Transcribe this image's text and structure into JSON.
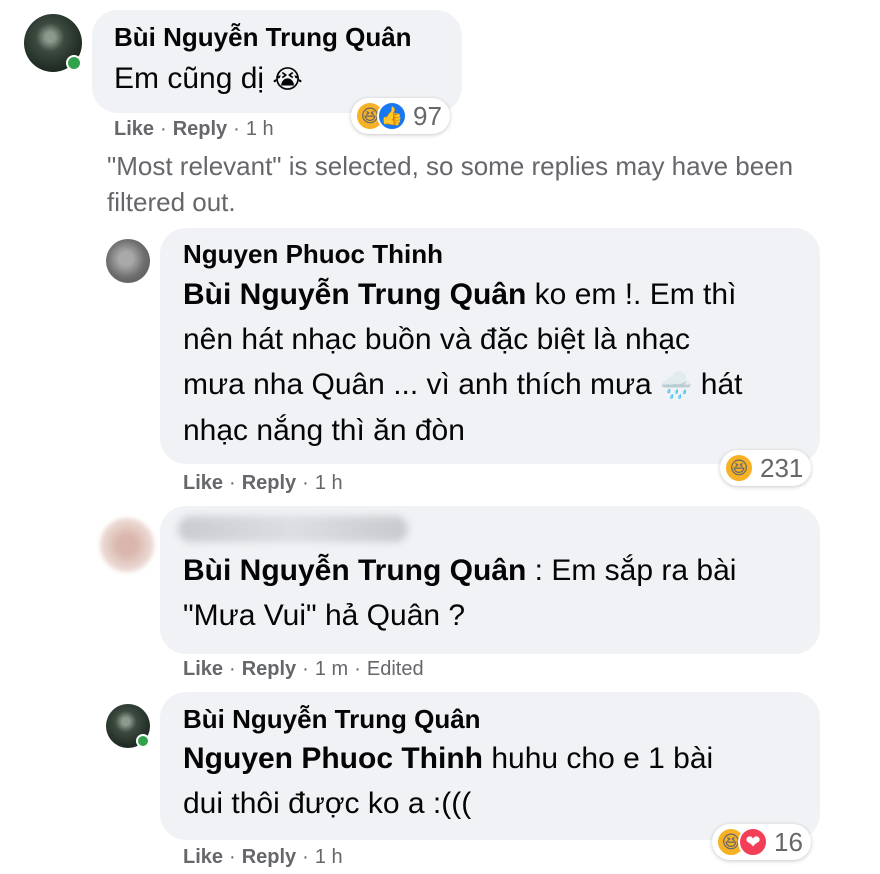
{
  "comments": [
    {
      "author": "Bùi Nguyễn Trung Quân",
      "text": "Em cũng dị",
      "emoji": "😭",
      "actions": {
        "like": "Like",
        "reply": "Reply",
        "time": "1 h"
      },
      "reactions": {
        "icons": [
          "haha-icon",
          "like-icon"
        ],
        "count": "97"
      }
    }
  ],
  "filter_notice": "\"Most relevant\" is selected, so some replies may have been filtered out.",
  "replies": [
    {
      "author": "Nguyen Phuoc Thinh",
      "mention": "Bùi Nguyễn Trung Quân",
      "line1": " ko em !. Em thì",
      "line2": "nên hát nhạc buồn và đặc biệt là nhạc",
      "line3a": "mưa nha Quân ... vì anh thích mưa",
      "line3_emoji": "🌧️",
      "line3b": " hát",
      "line4": "nhạc nắng thì ăn đòn",
      "actions": {
        "like": "Like",
        "reply": "Reply",
        "time": "1 h"
      },
      "reactions": {
        "icons": [
          "haha-icon"
        ],
        "count": "231"
      }
    },
    {
      "author": "",
      "mention": "Bùi Nguyễn Trung Quân",
      "line1": " : Em sắp ra bài",
      "line2": "\"Mưa Vui\" hả Quân ?",
      "actions": {
        "like": "Like",
        "reply": "Reply",
        "time": "1 m",
        "edited": "Edited"
      }
    },
    {
      "author": "Bùi Nguyễn Trung Quân",
      "mention": "Nguyen Phuoc Thinh",
      "line1": " huhu cho e 1 bài",
      "line2": "dui thôi được ko a :(((",
      "actions": {
        "like": "Like",
        "reply": "Reply",
        "time": "1 h"
      },
      "reactions": {
        "icons": [
          "haha-icon",
          "love-icon"
        ],
        "count": "16"
      }
    }
  ],
  "colors": {
    "bubble": "#f0f2f5",
    "meta": "#65676b",
    "online": "#31a24c",
    "like_blue": "#1877f2",
    "haha_yellow": "#f7b125",
    "love_red": "#f33e58"
  }
}
